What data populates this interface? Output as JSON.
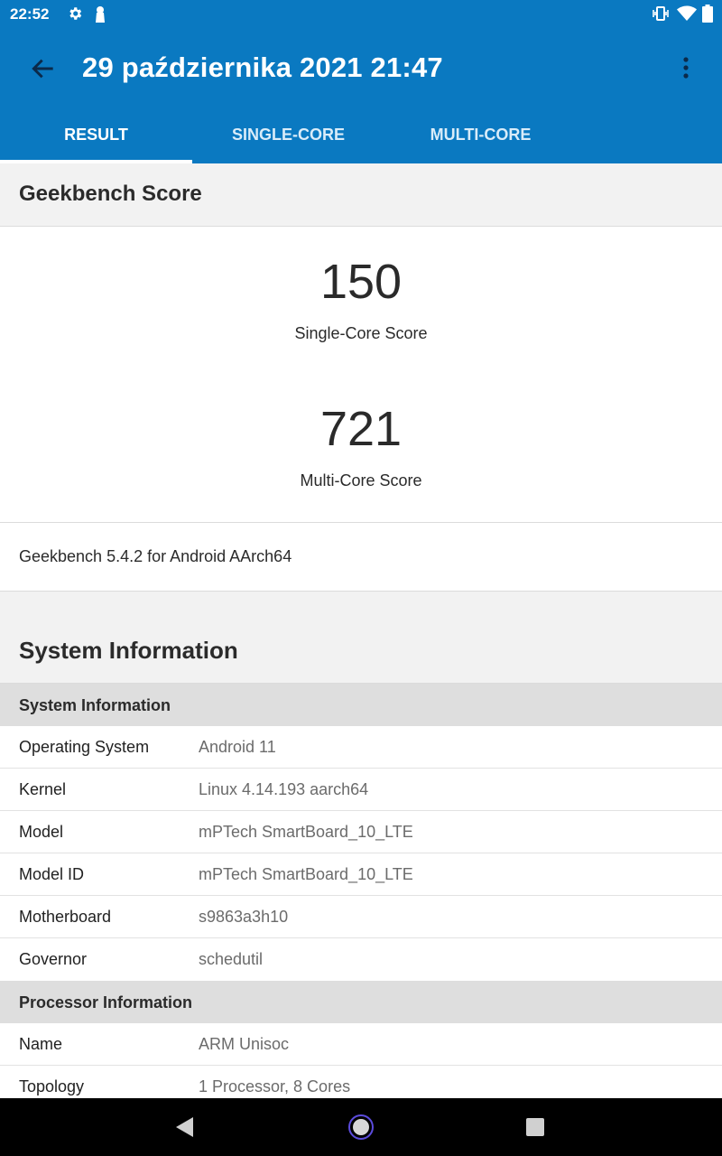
{
  "status_bar": {
    "time": "22:52"
  },
  "app_bar": {
    "title": "29 października 2021 21:47"
  },
  "tabs": [
    {
      "label": "RESULT",
      "active": true
    },
    {
      "label": "SINGLE-CORE",
      "active": false
    },
    {
      "label": "MULTI-CORE",
      "active": false
    }
  ],
  "score_section": {
    "title": "Geekbench Score",
    "single_core_value": "150",
    "single_core_label": "Single-Core Score",
    "multi_core_value": "721",
    "multi_core_label": "Multi-Core Score",
    "version": "Geekbench 5.4.2 for Android AArch64"
  },
  "system_information": {
    "title": "System Information",
    "groups": [
      {
        "title": "System Information",
        "rows": [
          {
            "key": "Operating System",
            "value": "Android 11"
          },
          {
            "key": "Kernel",
            "value": "Linux 4.14.193 aarch64"
          },
          {
            "key": "Model",
            "value": "mPTech SmartBoard_10_LTE"
          },
          {
            "key": "Model ID",
            "value": "mPTech SmartBoard_10_LTE"
          },
          {
            "key": "Motherboard",
            "value": "s9863a3h10"
          },
          {
            "key": "Governor",
            "value": "schedutil"
          }
        ]
      },
      {
        "title": "Processor Information",
        "rows": [
          {
            "key": "Name",
            "value": "ARM Unisoc"
          },
          {
            "key": "Topology",
            "value": "1 Processor, 8 Cores"
          }
        ]
      }
    ]
  },
  "colors": {
    "accent": "#0a79c1",
    "section_bg": "#f2f2f2",
    "group_bg": "#dedede"
  }
}
